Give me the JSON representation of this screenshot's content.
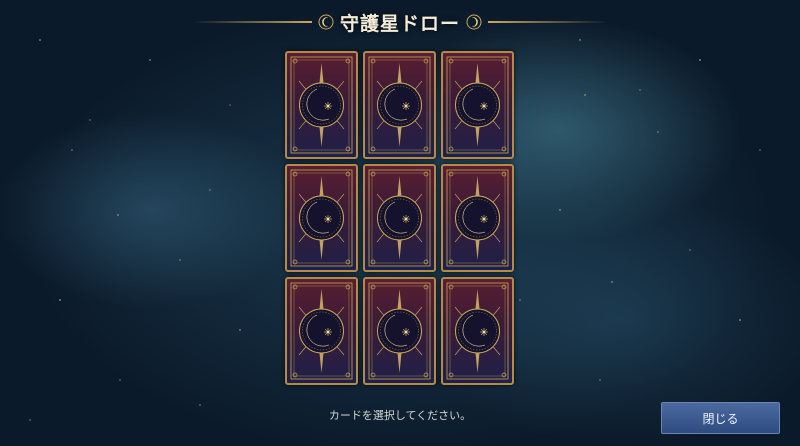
{
  "title": "守護星ドロー",
  "cards": [
    {
      "name": "card-1"
    },
    {
      "name": "card-2"
    },
    {
      "name": "card-3"
    },
    {
      "name": "card-4"
    },
    {
      "name": "card-5"
    },
    {
      "name": "card-6"
    },
    {
      "name": "card-7"
    },
    {
      "name": "card-8"
    },
    {
      "name": "card-9"
    }
  ],
  "hint": "カードを選択してください。",
  "close_button": "閉じる",
  "colors": {
    "gold": "#c9a95a",
    "card_top": "#5a1e30",
    "card_bottom": "#1f2048",
    "button": "#3b5a90"
  },
  "icons": {
    "title_ornament": "crescent-moon-icon",
    "card_emblem": "crescent-moon-icon"
  }
}
